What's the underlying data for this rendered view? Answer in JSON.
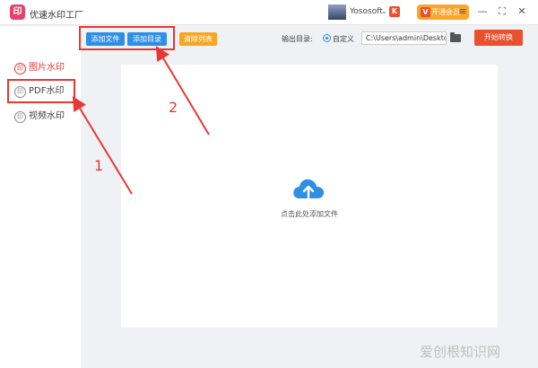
{
  "app": {
    "title": "优速水印工厂",
    "logo_text": "印"
  },
  "user": {
    "name": "Yososoft",
    "caret": "⌄",
    "badge": "K"
  },
  "vip": {
    "label": "开通会员",
    "icon": "V"
  },
  "window_controls": {
    "menu": "≡",
    "minimize": "—",
    "maximize": "⛶",
    "close": "✕"
  },
  "sidebar": {
    "items": [
      {
        "label": "图片水印",
        "icon": "印"
      },
      {
        "label": "PDF水印",
        "icon": "印"
      },
      {
        "label": "视频水印",
        "icon": "印"
      }
    ]
  },
  "toolbar": {
    "add_file": "添加文件",
    "add_folder": "添加目录",
    "clear_list": "清除列表",
    "output_label": "输出目录:",
    "custom_label": "自定义",
    "output_path": "C:\\Users\\admin\\Desktop",
    "start": "开始转换"
  },
  "dropzone": {
    "hint": "点击此处添加文件"
  },
  "annotations": {
    "one": "1",
    "two": "2",
    "accent": "#e53935"
  },
  "watermark": "爱创根知识网",
  "colors": {
    "primary": "#2f8ee6",
    "orange": "#f5a623",
    "start": "#e8502f",
    "accent": "#e53935"
  }
}
